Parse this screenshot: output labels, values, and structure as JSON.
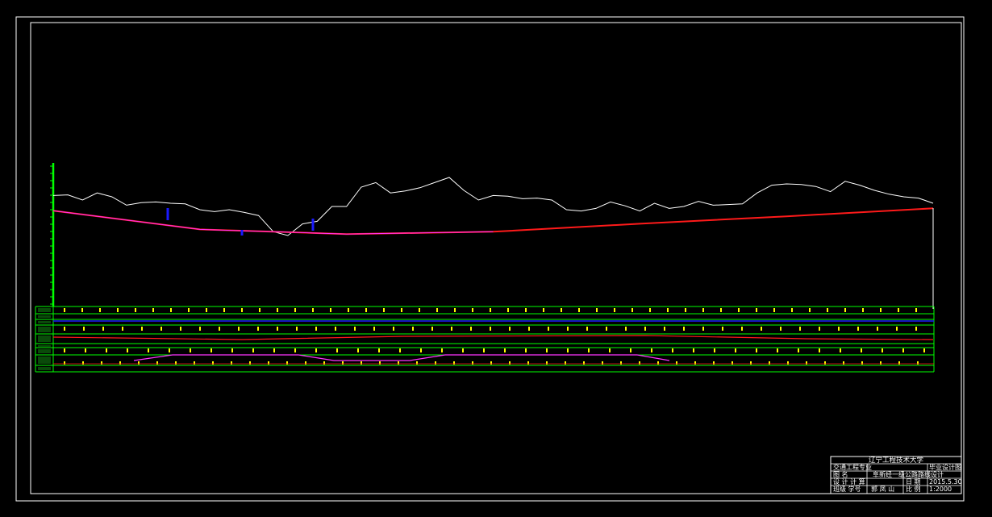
{
  "colors": {
    "background": "#000000",
    "frame": "#ffffff",
    "ground_line": "#ffffff",
    "design_grade": "#ff1a1a",
    "structure": "#1a1aff",
    "axis": "#00ff00",
    "band_lines": "#00ff00",
    "band_ticks": "#ffff00",
    "curve_marks": "#ff33ff"
  },
  "title_block": {
    "university": "辽宁工程技术大学",
    "major": "交通工程专业",
    "design_type": "毕业设计图",
    "drawing_label": "图 名",
    "drawing_name": "阜新经一级公路路线设计",
    "designer_label": "设 计 计 算",
    "date_label": "日 期",
    "date": "2015.5.30",
    "student_label": "班级 学号",
    "student_name": "郭 凤 山",
    "scale_label": "比 例",
    "scale": "1:2000"
  },
  "profile": {
    "ground_elevation_relative": [
      0.62,
      0.63,
      0.55,
      0.66,
      0.6,
      0.47,
      0.51,
      0.52,
      0.5,
      0.49,
      0.4,
      0.37,
      0.4,
      0.36,
      0.31,
      0.06,
      0.0,
      0.18,
      0.22,
      0.45,
      0.45,
      0.75,
      0.82,
      0.66,
      0.69,
      0.74,
      0.82,
      0.9,
      0.7,
      0.55,
      0.62,
      0.61,
      0.57,
      0.58,
      0.55,
      0.4,
      0.38,
      0.42,
      0.52,
      0.46,
      0.38,
      0.5,
      0.42,
      0.45,
      0.53,
      0.47,
      0.48,
      0.49,
      0.66,
      0.78,
      0.8,
      0.79,
      0.76,
      0.68,
      0.84,
      0.78,
      0.7,
      0.64,
      0.6,
      0.58,
      0.5
    ],
    "design_grade_relative": [
      0.6,
      0.2,
      0.1,
      0.15,
      0.32,
      0.48,
      0.65
    ],
    "structures": 3
  },
  "bands": {
    "rows": 9
  }
}
